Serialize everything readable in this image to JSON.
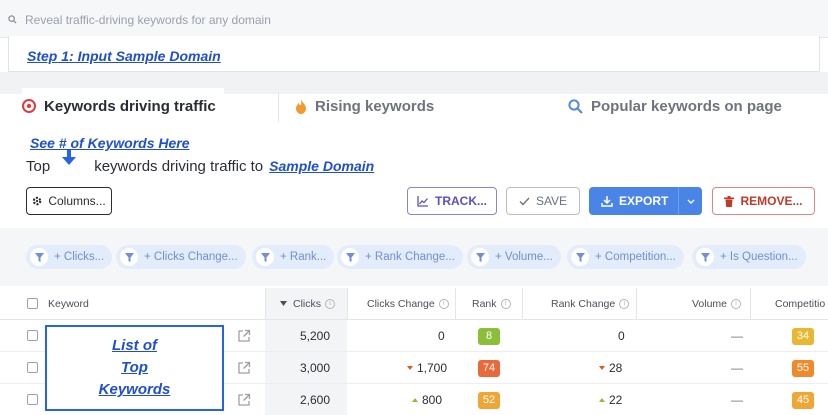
{
  "search": {
    "placeholder": "Reveal traffic-driving keywords for any domain"
  },
  "annotations": {
    "step1": "Step 1: Input Sample Domain",
    "see_count": "See # of Keywords Here",
    "list_lines": [
      "List of",
      "Top",
      "Keywords"
    ]
  },
  "tabs": [
    {
      "label": "Keywords driving traffic",
      "icon": "target-icon",
      "active": true
    },
    {
      "label": "Rising keywords",
      "icon": "flame-icon",
      "active": false
    },
    {
      "label": "Popular keywords on page",
      "icon": "search-icon",
      "active": false
    }
  ],
  "heading": {
    "prefix": "Top",
    "middle": "keywords driving traffic to",
    "domain": "Sample Domain"
  },
  "toolbar": {
    "columns": "Columns...",
    "track": "TRACK...",
    "save": "SAVE",
    "export": "EXPORT",
    "remove": "REMOVE..."
  },
  "filters": [
    "+ Clicks...",
    "+ Clicks Change...",
    "+ Rank...",
    "+ Rank Change...",
    "+ Volume...",
    "+ Competition...",
    "+ Is Question..."
  ],
  "table": {
    "headers": {
      "keyword": "Keyword",
      "clicks": "Clicks",
      "clicks_change": "Clicks Change",
      "rank": "Rank",
      "rank_change": "Rank Change",
      "volume": "Volume",
      "competition": "Competitio"
    },
    "rows": [
      {
        "clicks": "5,200",
        "clicks_change": "0",
        "clicks_trend": "none",
        "rank": "8",
        "rank_color": "#8bbf3a",
        "rank_change": "0",
        "rank_trend": "none",
        "volume": "—",
        "competition": "34",
        "competition_color": "#e8b830"
      },
      {
        "clicks": "3,000",
        "clicks_change": "1,700",
        "clicks_trend": "down",
        "rank": "74",
        "rank_color": "#e86a3a",
        "rank_change": "28",
        "rank_trend": "down",
        "volume": "—",
        "competition": "55",
        "competition_color": "#ef8a2a"
      },
      {
        "clicks": "2,600",
        "clicks_change": "800",
        "clicks_trend": "up",
        "rank": "52",
        "rank_color": "#f0a634",
        "rank_change": "22",
        "rank_trend": "up",
        "volume": "—",
        "competition": "45",
        "competition_color": "#f0a634"
      }
    ]
  }
}
